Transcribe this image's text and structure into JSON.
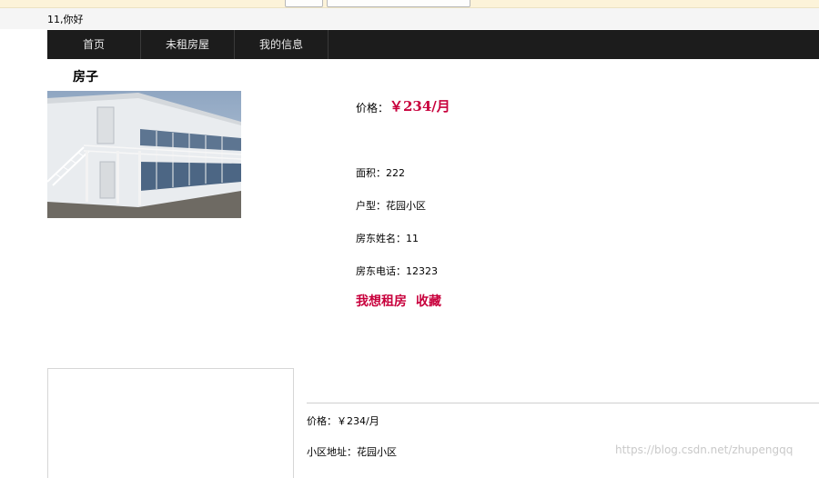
{
  "header": {
    "greeting": "11,你好"
  },
  "nav": {
    "items": [
      "首页",
      "未租房屋",
      "我的信息"
    ]
  },
  "detail": {
    "title": "房子",
    "price_label": "价格：",
    "price_value": "￥234/月",
    "area": "面积：222",
    "layout": "户型：花园小区",
    "landlord_name": "房东姓名：11",
    "landlord_phone": "房东电话：12323",
    "rent_action": "我想租房",
    "favorite_action": "收藏"
  },
  "listing": {
    "price": "价格：￥234/月",
    "address": "小区地址：花园小区"
  },
  "watermark": "https://blog.csdn.net/zhupengqq",
  "colors": {
    "accent": "#c8003c",
    "nav_bg": "#1c1c1c"
  }
}
